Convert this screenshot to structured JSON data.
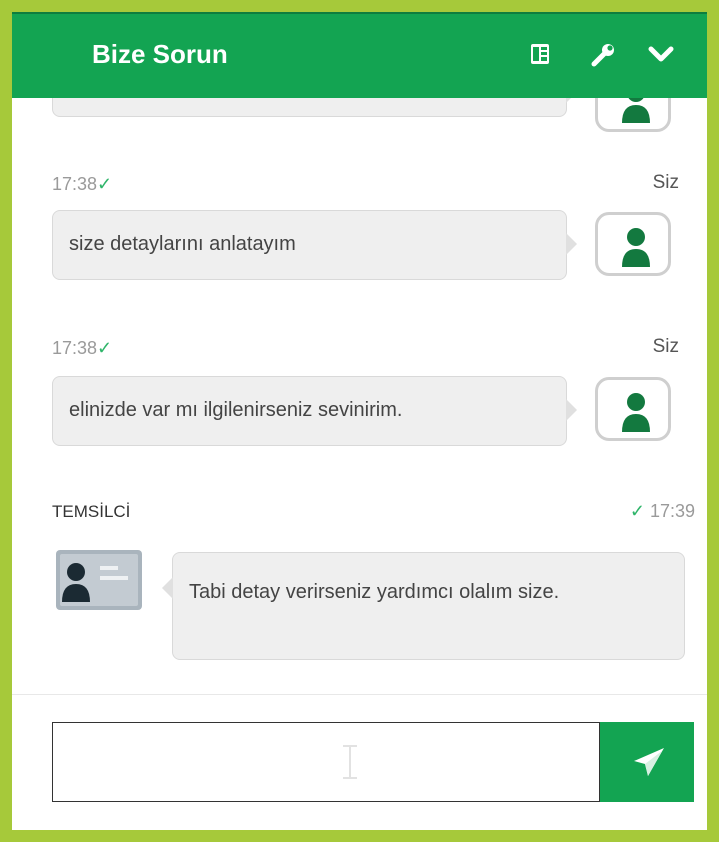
{
  "header": {
    "title": "Bize Sorun",
    "icons": [
      "language-book-icon",
      "wrench-icon",
      "chevron-down-icon"
    ]
  },
  "messages": [
    {
      "time": "17:38",
      "check": "✓",
      "sender": "Siz",
      "text": "size detaylarını anlatayım"
    },
    {
      "time": "17:38",
      "check": "✓",
      "sender": "Siz",
      "text": "elinizde var mı ilgilenirseniz sevinirim."
    }
  ],
  "agent_message": {
    "sender": "TEMSİLCİ",
    "check": "✓",
    "time": "17:39",
    "text": "Tabi detay verirseniz yardımcı olalım size."
  },
  "composer": {
    "value": "",
    "placeholder": ""
  },
  "colors": {
    "brand": "#13a452",
    "frame": "#a6c93a",
    "bubble": "#efefef",
    "check": "#2fb56a"
  }
}
